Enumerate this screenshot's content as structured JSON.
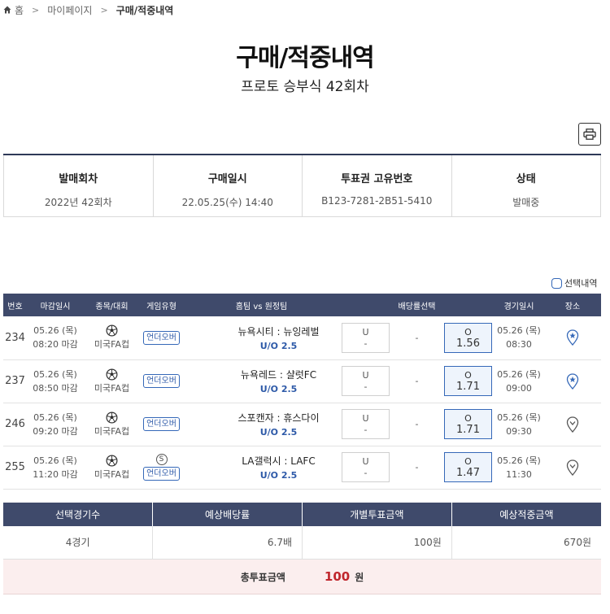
{
  "breadcrumb": {
    "home": "홈",
    "mypage": "마이페이지",
    "current": "구매/적중내역"
  },
  "header": {
    "title": "구매/적중내역",
    "subtitle": "프로토 승부식 42회차"
  },
  "info": [
    {
      "label": "발매회차",
      "value": "2022년 42회차"
    },
    {
      "label": "구매일시",
      "value": "22.05.25(수) 14:40"
    },
    {
      "label": "투표권 고유번호",
      "value": "B123-7281-2B51-5410"
    },
    {
      "label": "상태",
      "value": "발매중"
    }
  ],
  "selection_toggle": "선택내역",
  "table": {
    "headers": [
      "번호",
      "마감일시",
      "종목/대회",
      "게임유형",
      "홈팀 vs 원정팀",
      "배당률선택",
      "경기일시",
      "장소"
    ],
    "rows": [
      {
        "num": "234",
        "deadline_date": "05.26 (목)",
        "deadline_time": "08:20 마감",
        "league": "미국FA컵",
        "special": "",
        "type": "언더오버",
        "match": "뉴욕시티 : 뉴잉레벌",
        "uo": "U/O 2.5",
        "under_label": "U",
        "under_val": "-",
        "mid": "-",
        "over_label": "O",
        "over_val": "1.56",
        "game_date": "05.26 (목)",
        "game_time": "08:30",
        "venue": "home"
      },
      {
        "num": "237",
        "deadline_date": "05.26 (목)",
        "deadline_time": "08:50 마감",
        "league": "미국FA컵",
        "special": "",
        "type": "언더오버",
        "match": "뉴욕레드 : 샬럿FC",
        "uo": "U/O 2.5",
        "under_label": "U",
        "under_val": "-",
        "mid": "-",
        "over_label": "O",
        "over_val": "1.71",
        "game_date": "05.26 (목)",
        "game_time": "09:00",
        "venue": "home"
      },
      {
        "num": "246",
        "deadline_date": "05.26 (목)",
        "deadline_time": "09:20 마감",
        "league": "미국FA컵",
        "special": "",
        "type": "언더오버",
        "match": "스포캔자 : 휴스다이",
        "uo": "U/O 2.5",
        "under_label": "U",
        "under_val": "-",
        "mid": "-",
        "over_label": "O",
        "over_val": "1.71",
        "game_date": "05.26 (목)",
        "game_time": "09:30",
        "venue": "away"
      },
      {
        "num": "255",
        "deadline_date": "05.26 (목)",
        "deadline_time": "11:20 마감",
        "league": "미국FA컵",
        "special": "S",
        "type": "언더오버",
        "match": "LA갤럭시 : LAFC",
        "uo": "U/O 2.5",
        "under_label": "U",
        "under_val": "-",
        "mid": "-",
        "over_label": "O",
        "over_val": "1.47",
        "game_date": "05.26 (목)",
        "game_time": "11:30",
        "venue": "away"
      }
    ]
  },
  "summary": {
    "headers": [
      "선택경기수",
      "예상배당률",
      "개별투표금액",
      "예상적중금액"
    ],
    "values": [
      "4경기",
      "6.7배",
      "100원",
      "670원"
    ]
  },
  "total": {
    "label": "총투표금액",
    "value": "100",
    "unit": "원"
  },
  "colors": {
    "header_bg": "#3f4a6b",
    "accent": "#3568b8",
    "total_red": "#c0272d",
    "total_bg": "#fbeeee"
  }
}
